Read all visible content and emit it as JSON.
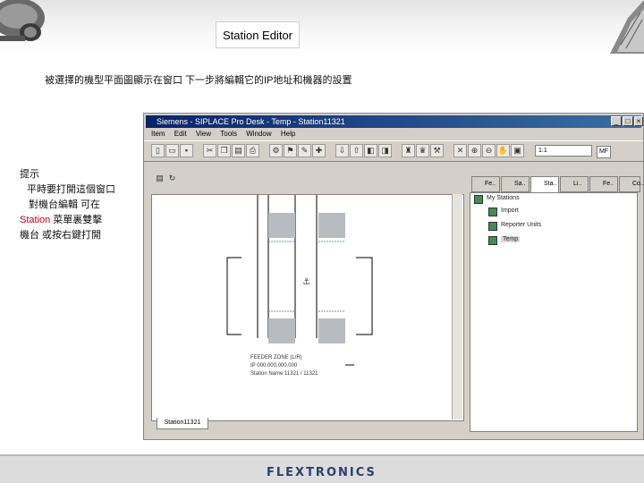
{
  "slide": {
    "title": "Station Editor",
    "subtitle": "被選擇的機型平面圖顯示在窗口 下一步將編輯它的IP地址和機器的設置",
    "side_note_1": "提示",
    "side_note_2": "平時要打開這個窗口",
    "side_note_3": "對機台編輯 可在",
    "side_note_4a": "Station",
    "side_note_4b": " 菜單裏雙擊",
    "side_note_5": "機台 或按右鍵打開",
    "footer_logo": "FLEXTRONICS"
  },
  "app": {
    "title": "Siemens - SIPLACE Pro Desk - Temp - Station11321",
    "menu": [
      "Item",
      "Edit",
      "View",
      "Tools",
      "Window",
      "Help"
    ],
    "combo_value": "1:1",
    "combo_label": "MF",
    "station_tab": "Station11321",
    "tabs": [
      "Fe..",
      "Sa..",
      "Sta..",
      "Li..",
      "Fe..",
      "Co.."
    ],
    "tree": {
      "root": "My Stations",
      "children": [
        "Import",
        "Reporter Units",
        "Temp"
      ]
    },
    "info_lines": [
      "FEEDER ZONE (L/R)",
      "IP 000.000.000.000",
      "Station Name 11321 / 11321"
    ]
  },
  "icons": {
    "new": "new-icon",
    "open": "open-icon",
    "save": "save-icon",
    "cut": "cut-icon",
    "copy": "copy-icon",
    "paste": "paste-icon",
    "print": "print-icon",
    "zoom": "zoom-icon",
    "anchor": "anchor-icon"
  }
}
